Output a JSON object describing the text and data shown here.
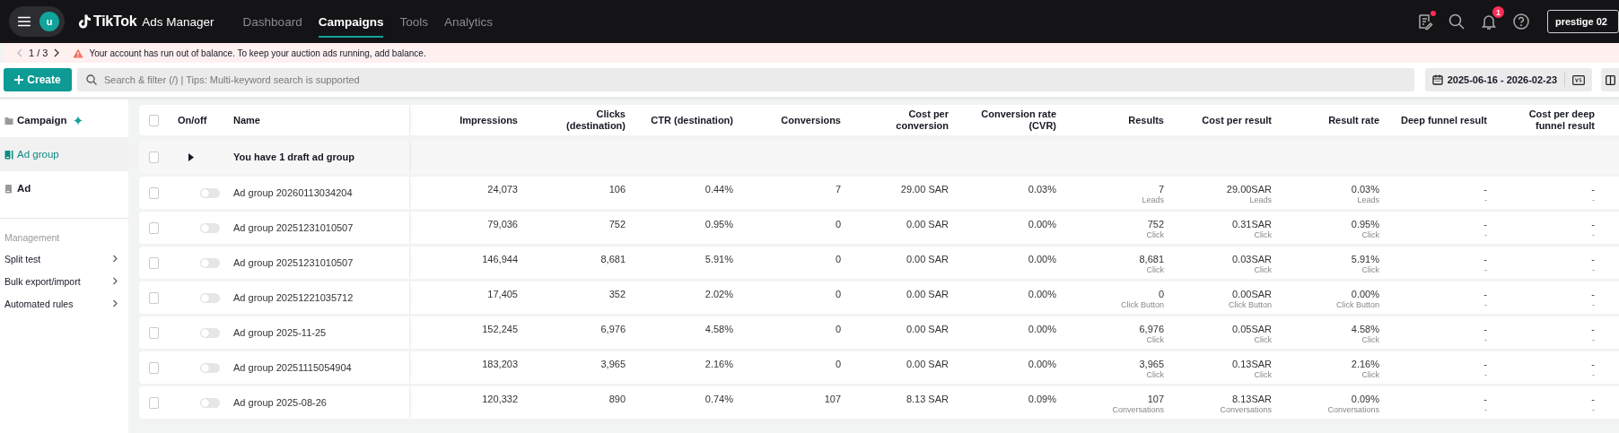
{
  "header": {
    "avatar": "u",
    "logo_brand": "TikTok",
    "logo_product": "Ads Manager",
    "nav": [
      {
        "label": "Dashboard",
        "selected": false
      },
      {
        "label": "Campaigns",
        "selected": true
      },
      {
        "label": "Tools",
        "selected": false
      },
      {
        "label": "Analytics",
        "selected": false
      }
    ],
    "notes_dot": true,
    "notifications_badge": "1",
    "account": "prestige 02"
  },
  "alert": {
    "pager": "1 / 3",
    "message": "Your account has run out of balance. To keep your auction ads running, add balance."
  },
  "toolbar": {
    "create": "Create",
    "search_placeholder": "Search & filter (/) | Tips: Multi-keyword search is supported",
    "date_range": "2025-06-16 - 2026-02-23"
  },
  "sidebar": {
    "levels": [
      {
        "label": "Campaign",
        "kind": "folder",
        "selected": false
      },
      {
        "label": "Ad group",
        "kind": "adgroup",
        "selected": true
      },
      {
        "label": "Ad",
        "kind": "ad",
        "selected": false
      }
    ],
    "section": "Management",
    "links": [
      "Split test",
      "Bulk export/import",
      "Automated rules"
    ]
  },
  "table": {
    "select_all_checked": false,
    "columns": [
      "On/off",
      "Name",
      "Impressions",
      "Clicks\n(destination)",
      "CTR (destination)",
      "Conversions",
      "Cost per\nconversion",
      "Conversion rate\n(CVR)",
      "Results",
      "Cost per result",
      "Result rate",
      "Deep funnel result",
      "Cost per deep\nfunnel result"
    ],
    "draft": {
      "text": "You have 1 draft ad group",
      "expanded": false,
      "checked": false
    },
    "rows": [
      {
        "checked": false,
        "cells": [
          {
            "kind": "switch",
            "on": false
          },
          {
            "kind": "name",
            "value": "Ad group 20260113034204"
          },
          {
            "value": "24,073"
          },
          {
            "value": "106"
          },
          {
            "value": "0.44%"
          },
          {
            "value": "7"
          },
          {
            "value": "29.00 SAR"
          },
          {
            "value": "0.03%"
          },
          {
            "value": "7",
            "sub": "Leads"
          },
          {
            "value": "29.00SAR",
            "sub": "Leads"
          },
          {
            "value": "0.03%",
            "sub": "Leads"
          },
          {
            "value": "-",
            "sub": "-"
          },
          {
            "value": "-",
            "sub": "-"
          }
        ]
      },
      {
        "checked": false,
        "cells": [
          {
            "kind": "switch",
            "on": false
          },
          {
            "kind": "name",
            "value": "Ad group 20251231010507"
          },
          {
            "value": "79,036"
          },
          {
            "value": "752"
          },
          {
            "value": "0.95%"
          },
          {
            "value": "0"
          },
          {
            "value": "0.00 SAR"
          },
          {
            "value": "0.00%"
          },
          {
            "value": "752",
            "sub": "Click"
          },
          {
            "value": "0.31SAR",
            "sub": "Click"
          },
          {
            "value": "0.95%",
            "sub": "Click"
          },
          {
            "value": "-",
            "sub": "-"
          },
          {
            "value": "-",
            "sub": "-"
          }
        ]
      },
      {
        "checked": false,
        "cells": [
          {
            "kind": "switch",
            "on": false
          },
          {
            "kind": "name",
            "value": "Ad group 20251231010507"
          },
          {
            "value": "146,944"
          },
          {
            "value": "8,681"
          },
          {
            "value": "5.91%"
          },
          {
            "value": "0"
          },
          {
            "value": "0.00 SAR"
          },
          {
            "value": "0.00%"
          },
          {
            "value": "8,681",
            "sub": "Click"
          },
          {
            "value": "0.03SAR",
            "sub": "Click"
          },
          {
            "value": "5.91%",
            "sub": "Click"
          },
          {
            "value": "-",
            "sub": "-"
          },
          {
            "value": "-",
            "sub": "-"
          }
        ]
      },
      {
        "checked": false,
        "cells": [
          {
            "kind": "switch",
            "on": false
          },
          {
            "kind": "name",
            "value": "Ad group 20251221035712"
          },
          {
            "value": "17,405"
          },
          {
            "value": "352"
          },
          {
            "value": "2.02%"
          },
          {
            "value": "0"
          },
          {
            "value": "0.00 SAR"
          },
          {
            "value": "0.00%"
          },
          {
            "value": "0",
            "sub": "Click Button"
          },
          {
            "value": "0.00SAR",
            "sub": "Click Button"
          },
          {
            "value": "0.00%",
            "sub": "Click Button"
          },
          {
            "value": "-",
            "sub": "-"
          },
          {
            "value": "-",
            "sub": "-"
          }
        ]
      },
      {
        "checked": false,
        "cells": [
          {
            "kind": "switch",
            "on": false
          },
          {
            "kind": "name",
            "value": "Ad group 2025-11-25"
          },
          {
            "value": "152,245"
          },
          {
            "value": "6,976"
          },
          {
            "value": "4.58%"
          },
          {
            "value": "0"
          },
          {
            "value": "0.00 SAR"
          },
          {
            "value": "0.00%"
          },
          {
            "value": "6,976",
            "sub": "Click"
          },
          {
            "value": "0.05SAR",
            "sub": "Click"
          },
          {
            "value": "4.58%",
            "sub": "Click"
          },
          {
            "value": "-",
            "sub": "-"
          },
          {
            "value": "-",
            "sub": "-"
          }
        ]
      },
      {
        "checked": false,
        "cells": [
          {
            "kind": "switch",
            "on": false
          },
          {
            "kind": "name",
            "value": "Ad group 20251115054904"
          },
          {
            "value": "183,203"
          },
          {
            "value": "3,965"
          },
          {
            "value": "2.16%"
          },
          {
            "value": "0"
          },
          {
            "value": "0.00 SAR"
          },
          {
            "value": "0.00%"
          },
          {
            "value": "3,965",
            "sub": "Click"
          },
          {
            "value": "0.13SAR",
            "sub": "Click"
          },
          {
            "value": "2.16%",
            "sub": "Click"
          },
          {
            "value": "-",
            "sub": "-"
          },
          {
            "value": "-",
            "sub": "-"
          }
        ]
      },
      {
        "checked": false,
        "cells": [
          {
            "kind": "switch",
            "on": false
          },
          {
            "kind": "name",
            "value": "Ad group 2025-08-26"
          },
          {
            "value": "120,332"
          },
          {
            "value": "890"
          },
          {
            "value": "0.74%"
          },
          {
            "value": "107"
          },
          {
            "value": "8.13 SAR"
          },
          {
            "value": "0.09%"
          },
          {
            "value": "107",
            "sub": "Conversations"
          },
          {
            "value": "8.13SAR",
            "sub": "Conversations"
          },
          {
            "value": "0.09%",
            "sub": "Conversations"
          },
          {
            "value": "-",
            "sub": "-"
          },
          {
            "value": "-",
            "sub": "-"
          }
        ]
      }
    ]
  }
}
